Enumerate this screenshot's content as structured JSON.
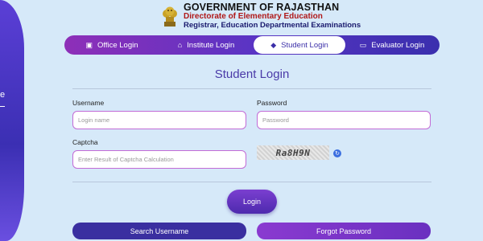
{
  "header": {
    "line1": "GOVERNMENT OF RAJASTHAN",
    "line2": "Directorate of Elementary Education",
    "line3": "Registrar, Education Departmental Examinations",
    "emblem_icon": "state-emblem-icon"
  },
  "side": {
    "glyph": "e"
  },
  "tabs": [
    {
      "label": "Office Login",
      "icon": "briefcase-icon",
      "active": false
    },
    {
      "label": "Institute Login",
      "icon": "institution-icon",
      "active": false
    },
    {
      "label": "Student Login",
      "icon": "graduation-cap-icon",
      "active": true
    },
    {
      "label": "Evaluator Login",
      "icon": "presentation-icon",
      "active": false
    }
  ],
  "form": {
    "title": "Student Login",
    "username_label": "Username",
    "username_placeholder": "Login name",
    "password_label": "Password",
    "password_placeholder": "Password",
    "captcha_label": "Captcha",
    "captcha_placeholder": "Enter Result of Captcha Calculation",
    "captcha_text": "Ra8H9N",
    "login_label": "Login",
    "search_username_label": "Search Username",
    "forgot_password_label": "Forgot Password"
  },
  "colors": {
    "accent": "#4a3aa8",
    "tab_gradient_start": "#8e2fb8",
    "tab_gradient_end": "#3a2fae",
    "input_border": "#c26bd6",
    "background": "#d6e9f9"
  }
}
